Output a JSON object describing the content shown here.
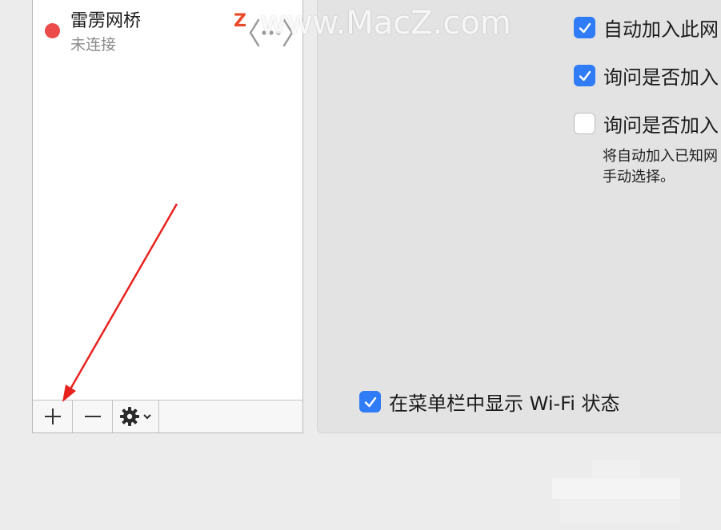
{
  "services": [
    {
      "name": "雷雳网桥",
      "status": "未连接",
      "status_color": "#ec4b4b",
      "icon": "thunderbolt-bridge-icon"
    }
  ],
  "list_toolbar": {
    "add_icon": "plus-icon",
    "remove_icon": "minus-icon",
    "action_icon": "gear-menu-icon"
  },
  "wifi_options": {
    "auto_join": {
      "label": "自动加入此网",
      "checked": true
    },
    "ask_join": {
      "label": "询问是否加入",
      "checked": true
    },
    "ask_hotspot": {
      "label": "询问是否加入",
      "checked": false
    },
    "note_line1": "将自动加入已知网",
    "note_line2": "手动选择。",
    "show_menubar": {
      "label": "在菜单栏中显示 Wi-Fi 状态",
      "checked": true
    }
  },
  "watermark": {
    "text": "www.MacZ.com",
    "logo_letter": "Z"
  },
  "colors": {
    "accent": "#2f7cf6",
    "arrow": "#e8231f"
  }
}
